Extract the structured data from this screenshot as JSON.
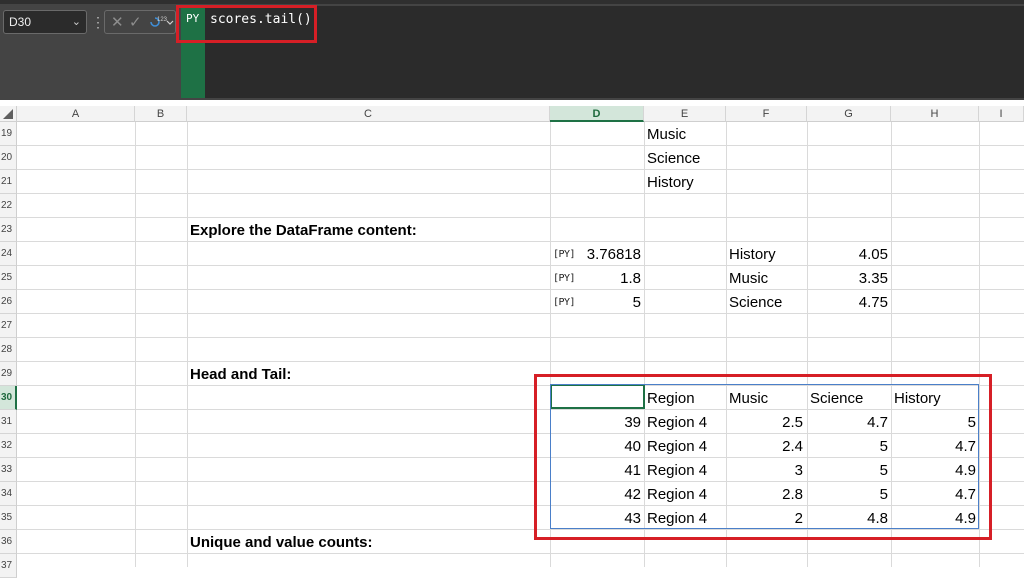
{
  "name_box": "D30",
  "formula": {
    "tag": "PY",
    "text": "scores.tail()",
    "type_indicator": "123"
  },
  "columns": [
    "A",
    "B",
    "C",
    "D",
    "E",
    "F",
    "G",
    "H",
    "I"
  ],
  "selected_column": "D",
  "selected_row": "30",
  "rows": [
    "19",
    "20",
    "21",
    "22",
    "23",
    "24",
    "25",
    "26",
    "27",
    "28",
    "29",
    "30",
    "31",
    "32",
    "33",
    "34",
    "35",
    "36",
    "37"
  ],
  "subjects_list": [
    "Music",
    "Science",
    "History"
  ],
  "sections": {
    "explore": "Explore the DataFrame content:",
    "head_tail": "Head and Tail:",
    "unique": "Unique and value counts:"
  },
  "py_badge": "[PY]",
  "stats": [
    {
      "value": "3.76818",
      "subject": "History",
      "mean": "4.05"
    },
    {
      "value": "1.8",
      "subject": "Music",
      "mean": "3.35"
    },
    {
      "value": "5",
      "subject": "Science",
      "mean": "4.75"
    }
  ],
  "tail_table": {
    "headers": [
      "",
      "Region",
      "Music",
      "Science",
      "History"
    ],
    "rows": [
      [
        "39",
        "Region 4",
        "2.5",
        "4.7",
        "5"
      ],
      [
        "40",
        "Region 4",
        "2.4",
        "5",
        "4.7"
      ],
      [
        "41",
        "Region 4",
        "3",
        "5",
        "4.9"
      ],
      [
        "42",
        "Region 4",
        "2.8",
        "5",
        "4.7"
      ],
      [
        "43",
        "Region 4",
        "2",
        "4.8",
        "4.9"
      ]
    ]
  },
  "colors": {
    "python_green": "#1e7145",
    "highlight_red": "#d61f26",
    "table_border": "#4a7fc9"
  }
}
